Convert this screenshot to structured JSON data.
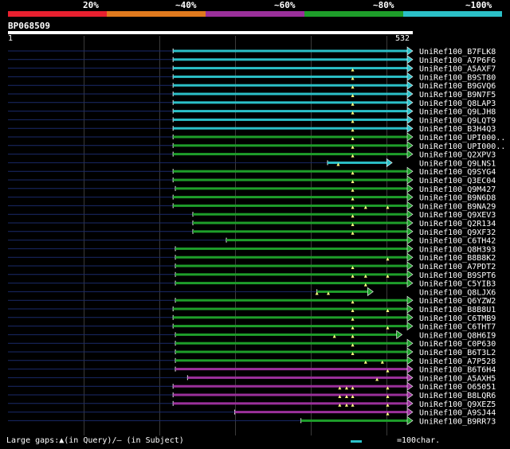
{
  "legend": {
    "segments": [
      {
        "label": "20%",
        "color": "#e8202f"
      },
      {
        "label": "~40%",
        "color": "#e07a1e"
      },
      {
        "label": "~60%",
        "color": "#9b309b"
      },
      {
        "label": "~80%",
        "color": "#1e9e2a"
      },
      {
        "label": "~100%",
        "color": "#2bc0c8"
      }
    ]
  },
  "query": {
    "id": "BP068509",
    "start": "1",
    "end": "532",
    "length": 532
  },
  "hits": [
    {
      "name": "UniRef100_B7FLK8",
      "start": 217,
      "color": "#2bc0c8",
      "arrow_end": 532,
      "marks": []
    },
    {
      "name": "UniRef100_A7P6F6",
      "start": 217,
      "color": "#2bc0c8",
      "arrow_end": 532,
      "marks": []
    },
    {
      "name": "UniRef100_A5AXF7",
      "start": 217,
      "color": "#2bc0c8",
      "arrow_end": 532,
      "marks": [
        453
      ]
    },
    {
      "name": "UniRef100_B9ST80",
      "start": 217,
      "color": "#2bc0c8",
      "arrow_end": 532,
      "marks": [
        453
      ]
    },
    {
      "name": "UniRef100_B9GVQ6",
      "start": 217,
      "color": "#2bc0c8",
      "arrow_end": 532,
      "marks": [
        453
      ]
    },
    {
      "name": "UniRef100_B9N7F5",
      "start": 217,
      "color": "#2bc0c8",
      "arrow_end": 532,
      "marks": [
        453
      ]
    },
    {
      "name": "UniRef100_Q8LAP3",
      "start": 217,
      "color": "#2bc0c8",
      "arrow_end": 532,
      "marks": [
        453
      ]
    },
    {
      "name": "UniRef100_Q9LJH8",
      "start": 217,
      "color": "#2bc0c8",
      "arrow_end": 532,
      "marks": [
        453
      ]
    },
    {
      "name": "UniRef100_Q9LQT9",
      "start": 217,
      "color": "#2bc0c8",
      "arrow_end": 532,
      "marks": [
        453
      ]
    },
    {
      "name": "UniRef100_B3H4Q3",
      "start": 217,
      "color": "#2bc0c8",
      "arrow_end": 532,
      "marks": [
        453
      ]
    },
    {
      "name": "UniRef100_UPI000..",
      "start": 217,
      "color": "#1e9e2a",
      "arrow_end": 532,
      "marks": [
        453
      ]
    },
    {
      "name": "UniRef100_UPI000..",
      "start": 217,
      "color": "#1e9e2a",
      "arrow_end": 532,
      "marks": [
        453
      ]
    },
    {
      "name": "UniRef100_Q2XPV3",
      "start": 217,
      "color": "#1e9e2a",
      "arrow_end": 532,
      "marks": [
        453
      ]
    },
    {
      "name": "UniRef100_Q9LNS1",
      "start": 420,
      "color": "#2bc0c8",
      "arrow_end": 505,
      "marks": [
        434
      ]
    },
    {
      "name": "UniRef100_Q9SYG4",
      "start": 217,
      "color": "#1e9e2a",
      "arrow_end": 532,
      "marks": [
        453
      ]
    },
    {
      "name": "UniRef100_Q3EC04",
      "start": 217,
      "color": "#1e9e2a",
      "arrow_end": 532,
      "marks": [
        453
      ]
    },
    {
      "name": "UniRef100_Q9M427",
      "start": 220,
      "color": "#1e9e2a",
      "arrow_end": 532,
      "marks": [
        453
      ]
    },
    {
      "name": "UniRef100_B9N6D8",
      "start": 217,
      "color": "#1e9e2a",
      "arrow_end": 532,
      "marks": [
        453
      ]
    },
    {
      "name": "UniRef100_B9NA29",
      "start": 217,
      "color": "#1e9e2a",
      "arrow_end": 532,
      "marks": [
        453,
        470,
        499
      ]
    },
    {
      "name": "UniRef100_Q9XEV3",
      "start": 243,
      "color": "#1e9e2a",
      "arrow_end": 532,
      "marks": [
        453
      ]
    },
    {
      "name": "UniRef100_Q2R134",
      "start": 243,
      "color": "#1e9e2a",
      "arrow_end": 532,
      "marks": [
        453
      ]
    },
    {
      "name": "UniRef100_Q9XF32",
      "start": 243,
      "color": "#1e9e2a",
      "arrow_end": 532,
      "marks": [
        453
      ]
    },
    {
      "name": "UniRef100_C6TH42",
      "start": 287,
      "color": "#1e9e2a",
      "arrow_end": 532,
      "marks": []
    },
    {
      "name": "UniRef100_Q8H393",
      "start": 220,
      "color": "#1e9e2a",
      "arrow_end": 532,
      "marks": []
    },
    {
      "name": "UniRef100_B8B8K2",
      "start": 220,
      "color": "#1e9e2a",
      "arrow_end": 532,
      "marks": [
        499
      ]
    },
    {
      "name": "UniRef100_A7PDT2",
      "start": 220,
      "color": "#1e9e2a",
      "arrow_end": 532,
      "marks": [
        453
      ]
    },
    {
      "name": "UniRef100_B9SPT6",
      "start": 220,
      "color": "#1e9e2a",
      "arrow_end": 532,
      "marks": [
        453,
        470,
        499
      ]
    },
    {
      "name": "UniRef100_C5YIB3",
      "start": 220,
      "color": "#1e9e2a",
      "arrow_end": 532,
      "marks": [
        470
      ]
    },
    {
      "name": "UniRef100_Q8LJX6",
      "start": 406,
      "color": "#1e9e2a",
      "arrow_end": 480,
      "marks": [
        406,
        421
      ]
    },
    {
      "name": "UniRef100_Q6YZW2",
      "start": 220,
      "color": "#1e9e2a",
      "arrow_end": 532,
      "marks": [
        453
      ]
    },
    {
      "name": "UniRef100_B8B8U1",
      "start": 217,
      "color": "#1e9e2a",
      "arrow_end": 532,
      "marks": [
        453,
        499
      ]
    },
    {
      "name": "UniRef100_C6TMB9",
      "start": 217,
      "color": "#1e9e2a",
      "arrow_end": 532,
      "marks": [
        453
      ]
    },
    {
      "name": "UniRef100_C6THT7",
      "start": 217,
      "color": "#1e9e2a",
      "arrow_end": 532,
      "marks": [
        453,
        499
      ]
    },
    {
      "name": "UniRef100_Q8H6I9",
      "start": 220,
      "color": "#1e9e2a",
      "arrow_end": 518,
      "marks": [
        429,
        453
      ]
    },
    {
      "name": "UniRef100_C0P630",
      "start": 220,
      "color": "#1e9e2a",
      "arrow_end": 532,
      "marks": [
        453
      ]
    },
    {
      "name": "UniRef100_B6T3L2",
      "start": 220,
      "color": "#1e9e2a",
      "arrow_end": 532,
      "marks": [
        453
      ]
    },
    {
      "name": "UniRef100_A7P528",
      "start": 220,
      "color": "#1e9e2a",
      "arrow_end": 532,
      "marks": [
        470,
        492
      ]
    },
    {
      "name": "UniRef100_B6T6H4",
      "start": 220,
      "color": "#9b309b",
      "arrow_end": 532,
      "marks": [
        499
      ]
    },
    {
      "name": "UniRef100_A5AXH5",
      "start": 236,
      "color": "#9b309b",
      "arrow_end": 532,
      "marks": [
        485
      ]
    },
    {
      "name": "UniRef100_O65051",
      "start": 217,
      "color": "#9b309b",
      "arrow_end": 532,
      "marks": [
        436,
        445,
        453,
        499
      ]
    },
    {
      "name": "UniRef100_B8LQR6",
      "start": 217,
      "color": "#9b309b",
      "arrow_end": 532,
      "marks": [
        436,
        445,
        453,
        499
      ]
    },
    {
      "name": "UniRef100_Q9XEZ5",
      "start": 217,
      "color": "#9b309b",
      "arrow_end": 532,
      "marks": [
        436,
        445,
        453,
        499
      ]
    },
    {
      "name": "UniRef100_A9SJ44",
      "start": 298,
      "color": "#9b309b",
      "arrow_end": 532,
      "marks": [
        499
      ]
    },
    {
      "name": "UniRef100_B9RR73",
      "start": 385,
      "color": "#1e9e2a",
      "arrow_end": 532,
      "marks": []
    }
  ],
  "footer": {
    "gaps_label": "Large gaps:▲(in Query)/– (in Subject)",
    "scale_label": "=100char."
  }
}
